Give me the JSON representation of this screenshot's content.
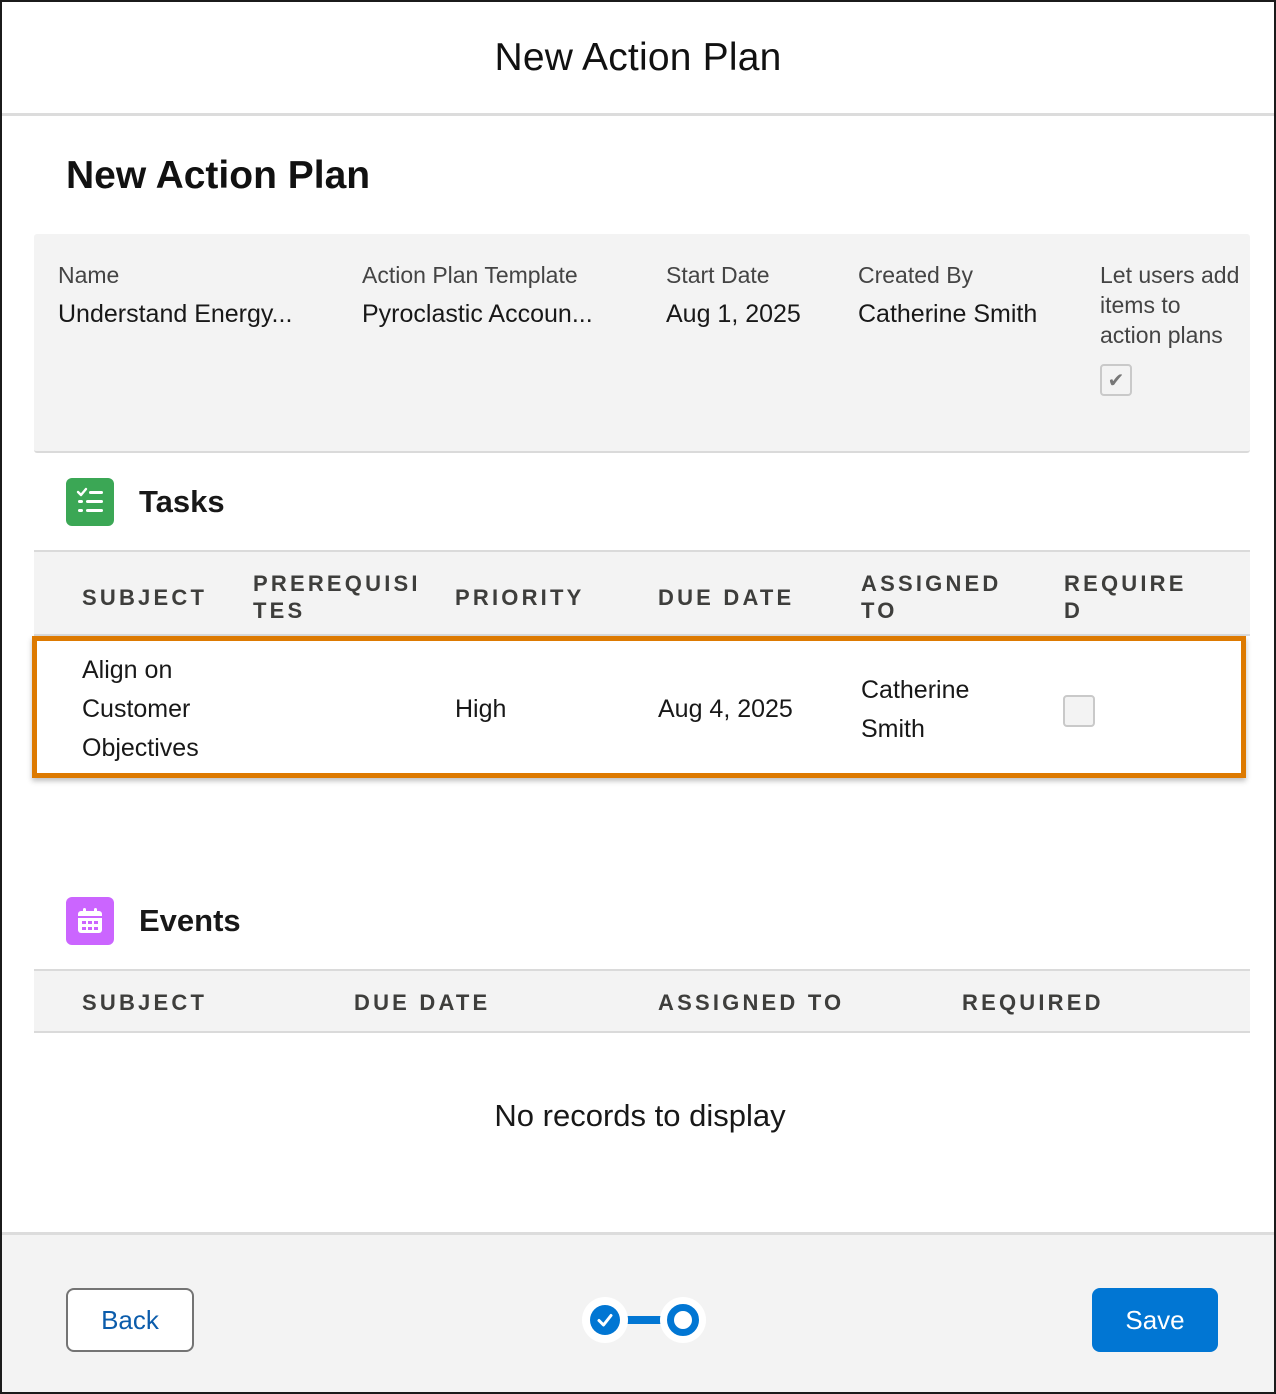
{
  "modal": {
    "title": "New Action Plan"
  },
  "page": {
    "title": "New Action Plan"
  },
  "summary": {
    "name": {
      "label": "Name",
      "value": "Understand Energy..."
    },
    "template": {
      "label": "Action Plan Template",
      "value": "Pyroclastic Accoun..."
    },
    "start_date": {
      "label": "Start Date",
      "value": "Aug 1, 2025"
    },
    "created_by": {
      "label": "Created By",
      "value": "Catherine Smith"
    },
    "let_users_add": {
      "label": "Let users add items to action plans",
      "checked": true
    }
  },
  "tasks": {
    "title": "Tasks",
    "columns": [
      "SUBJECT",
      "PREREQUISI TES",
      "PRIORITY",
      "DUE DATE",
      "ASSIGNED TO",
      "REQUIRE D"
    ],
    "rows": [
      {
        "subject": "Align on Customer Objectives",
        "prerequisites": "",
        "priority": "High",
        "due_date": "Aug 4, 2025",
        "assigned_to": "Catherine Smith",
        "required": false
      }
    ]
  },
  "events": {
    "title": "Events",
    "columns": [
      "SUBJECT",
      "DUE DATE",
      "ASSIGNED TO",
      "REQUIRED"
    ],
    "empty_text": "No records to display"
  },
  "footer": {
    "back_label": "Back",
    "save_label": "Save",
    "progress": {
      "total_steps": 2,
      "current_step": 2
    }
  },
  "colors": {
    "brand": "#0176d3",
    "highlight": "#dd7a01",
    "tasks_icon": "#3ba755",
    "events_icon": "#cb65ff"
  },
  "icons": {
    "tasks": "task-list-icon",
    "events": "calendar-icon",
    "check": "check-icon"
  }
}
